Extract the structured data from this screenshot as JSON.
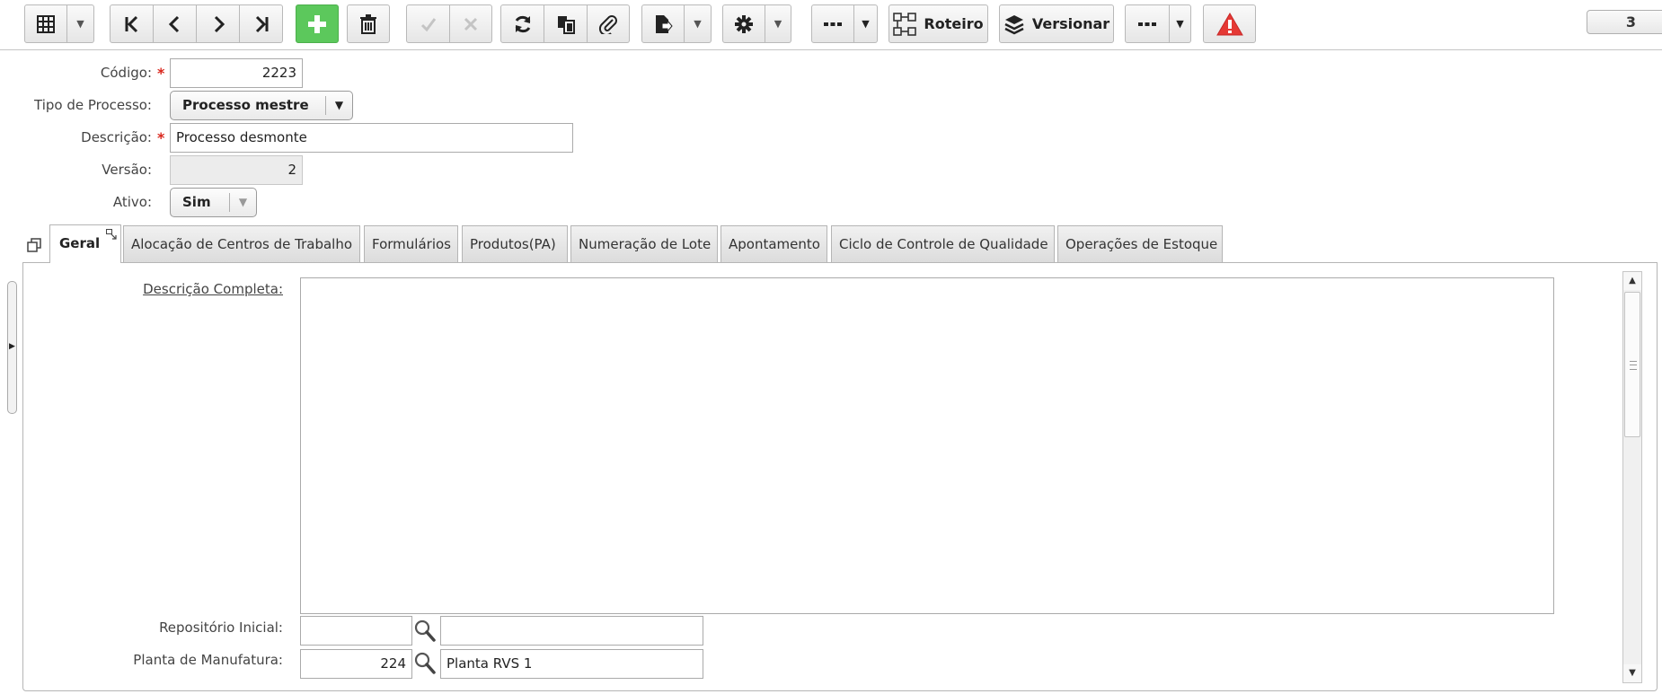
{
  "toolbar": {
    "buttons": [
      {
        "name": "grid-view",
        "icon": "grid-icon"
      },
      {
        "name": "first-record",
        "icon": "first-icon"
      },
      {
        "name": "previous-record",
        "icon": "previous-icon"
      },
      {
        "name": "next-record",
        "icon": "next-icon"
      },
      {
        "name": "last-record",
        "icon": "last-icon"
      },
      {
        "name": "add-record",
        "icon": "plus-icon"
      },
      {
        "name": "delete-record",
        "icon": "trash-icon"
      },
      {
        "name": "confirm",
        "icon": "check-icon"
      },
      {
        "name": "cancel",
        "icon": "x-icon"
      },
      {
        "name": "refresh",
        "icon": "refresh-icon"
      },
      {
        "name": "duplicate",
        "icon": "copy-icon"
      },
      {
        "name": "attach",
        "icon": "paperclip-icon"
      },
      {
        "name": "export",
        "icon": "export-icon"
      },
      {
        "name": "settings",
        "icon": "gear-icon"
      },
      {
        "name": "more-options",
        "icon": "ellipsis-icon"
      },
      {
        "name": "more-actions",
        "icon": "ellipsis-icon"
      },
      {
        "name": "alert",
        "icon": "warning-icon"
      }
    ],
    "roteiro_label": "Roteiro",
    "versionar_label": "Versionar",
    "record_counter": "3",
    "accent_green": "#5cc85c",
    "alert_red": "#e53935"
  },
  "form": {
    "codigo": {
      "label": "Código:",
      "value": "2223",
      "required": true
    },
    "tipo_processo": {
      "label": "Tipo de Processo:",
      "value": "Processo mestre"
    },
    "descricao": {
      "label": "Descrição:",
      "value": "Processo desmonte",
      "required": true
    },
    "versao": {
      "label": "Versão:",
      "value": "2"
    },
    "ativo": {
      "label": "Ativo:",
      "value": "Sim"
    },
    "required_marker": "*"
  },
  "tabs": [
    {
      "label": "Geral",
      "active": true
    },
    {
      "label": "Alocação de Centros de Trabalho"
    },
    {
      "label": "Formulários"
    },
    {
      "label": "Produtos(PA)"
    },
    {
      "label": "Numeração de Lote"
    },
    {
      "label": "Apontamento"
    },
    {
      "label": "Ciclo de Controle de Qualidade"
    },
    {
      "label": "Operações de Estoque"
    }
  ],
  "geral": {
    "descricao_completa": {
      "label": "Descrição Completa:",
      "value": ""
    },
    "repositorio_inicial": {
      "label": "Repositório Inicial:",
      "code": "",
      "name": ""
    },
    "planta_manufatura": {
      "label": "Planta de Manufatura:",
      "code": "224",
      "name": "Planta RVS 1"
    }
  }
}
